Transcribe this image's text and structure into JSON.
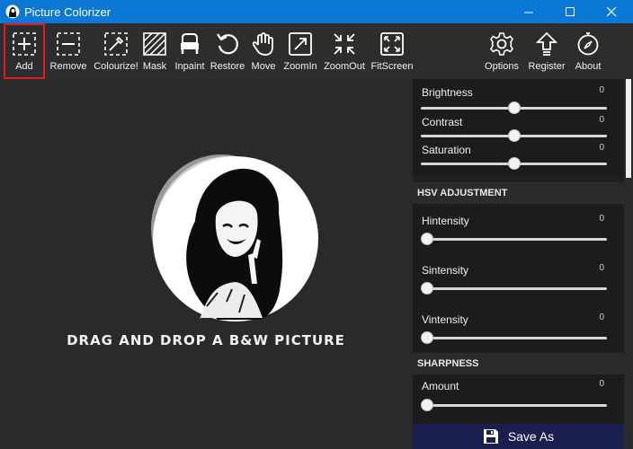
{
  "window": {
    "title": "Picture Colorizer"
  },
  "toolbar": {
    "add": "Add",
    "remove": "Remove",
    "colourize": "Colourize!",
    "mask": "Mask",
    "inpaint": "Inpaint",
    "restore": "Restore",
    "move": "Move",
    "zoomin": "ZoomIn",
    "zoomout": "ZoomOut",
    "fitscreen": "FitScreen",
    "options": "Options",
    "register": "Register",
    "about": "About"
  },
  "canvas": {
    "drop_text": "DRAG AND DROP A B&W PICTURE"
  },
  "panel": {
    "brightness": {
      "label": "Brightness",
      "value": "0",
      "level": 0.5
    },
    "contrast": {
      "label": "Contrast",
      "value": "0",
      "level": 0.5
    },
    "saturation": {
      "label": "Saturation",
      "value": "0",
      "level": 0.5
    },
    "hsv_header": "HSV ADJUSTMENT",
    "hintensity": {
      "label": "Hintensity",
      "value": "0",
      "level": 0
    },
    "sintensity": {
      "label": "Sintensity",
      "value": "0",
      "level": 0
    },
    "vintensity": {
      "label": "Vintensity",
      "value": "0",
      "level": 0
    },
    "sharpness_header": "SHARPNESS",
    "amount": {
      "label": "Amount",
      "value": "0",
      "level": 0
    }
  },
  "save_button": "Save As",
  "colors": {
    "titlebar": "#0a78d4",
    "selected_outline": "#e01b1b",
    "save_bg": "#1b1f4f"
  }
}
